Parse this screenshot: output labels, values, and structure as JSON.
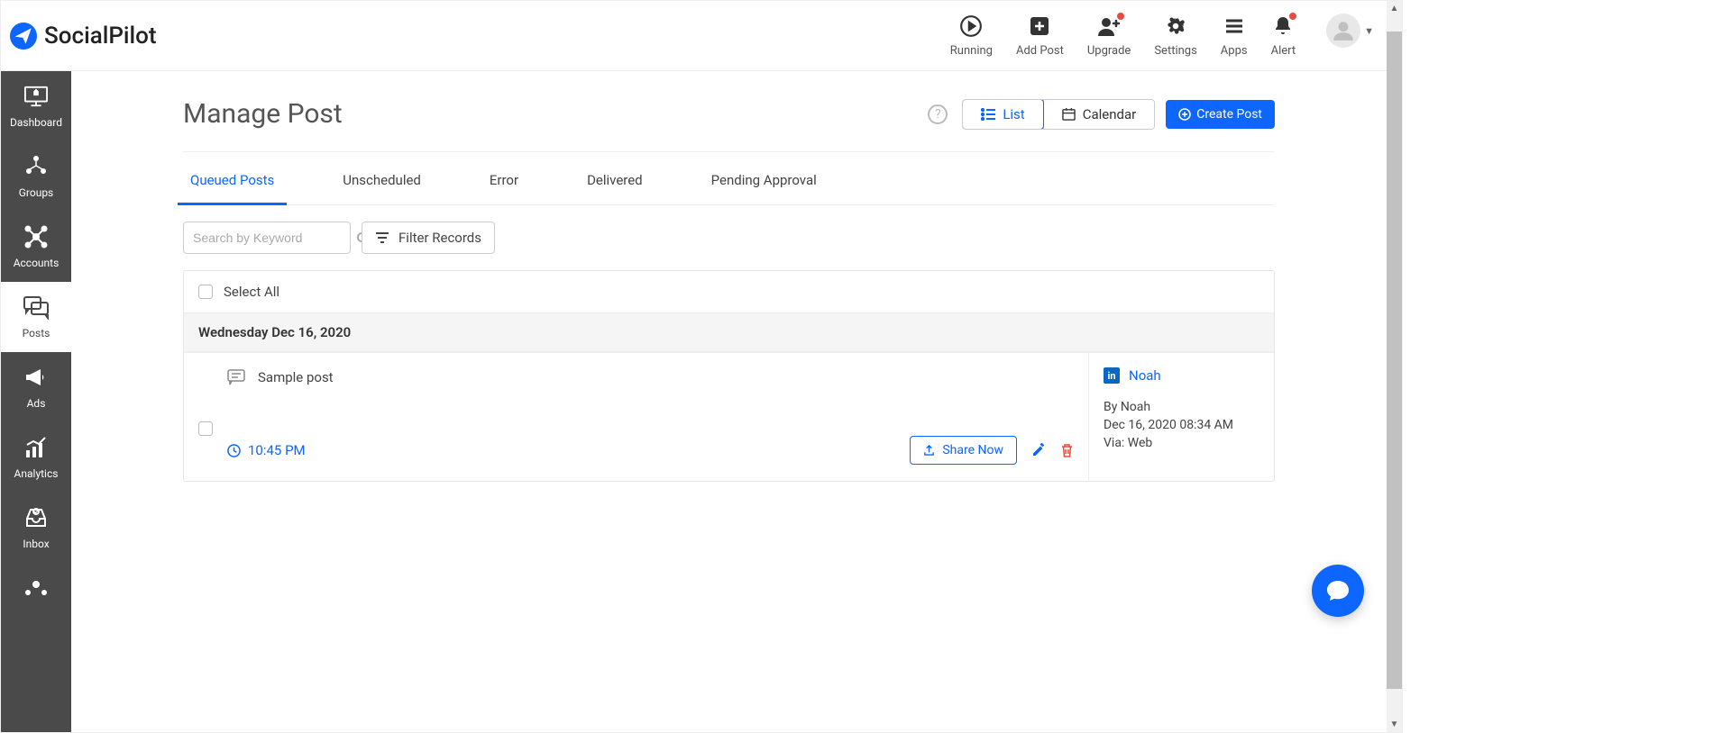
{
  "brand": "SocialPilot",
  "header": {
    "actions": [
      {
        "key": "running",
        "label": "Running"
      },
      {
        "key": "addpost",
        "label": "Add Post"
      },
      {
        "key": "upgrade",
        "label": "Upgrade"
      },
      {
        "key": "settings",
        "label": "Settings"
      },
      {
        "key": "apps",
        "label": "Apps"
      },
      {
        "key": "alert",
        "label": "Alert"
      }
    ]
  },
  "sidebar": {
    "items": [
      {
        "key": "dashboard",
        "label": "Dashboard"
      },
      {
        "key": "groups",
        "label": "Groups"
      },
      {
        "key": "accounts",
        "label": "Accounts"
      },
      {
        "key": "posts",
        "label": "Posts"
      },
      {
        "key": "ads",
        "label": "Ads"
      },
      {
        "key": "analytics",
        "label": "Analytics"
      },
      {
        "key": "inbox",
        "label": "Inbox"
      }
    ]
  },
  "page": {
    "title": "Manage Post",
    "view_list": "List",
    "view_calendar": "Calendar",
    "create_post": "Create Post"
  },
  "tabs": [
    "Queued Posts",
    "Unscheduled",
    "Error",
    "Delivered",
    "Pending Approval"
  ],
  "search": {
    "placeholder": "Search by Keyword"
  },
  "filter_label": "Filter Records",
  "posts": {
    "select_all": "Select All",
    "date_header": "Wednesday Dec 16, 2020",
    "item": {
      "text": "Sample post",
      "time": "10:45 PM",
      "share_now": "Share Now"
    },
    "side": {
      "account_name": "Noah",
      "by_line": "By Noah",
      "timestamp": "Dec 16, 2020 08:34 AM",
      "via": "Via: Web"
    }
  }
}
